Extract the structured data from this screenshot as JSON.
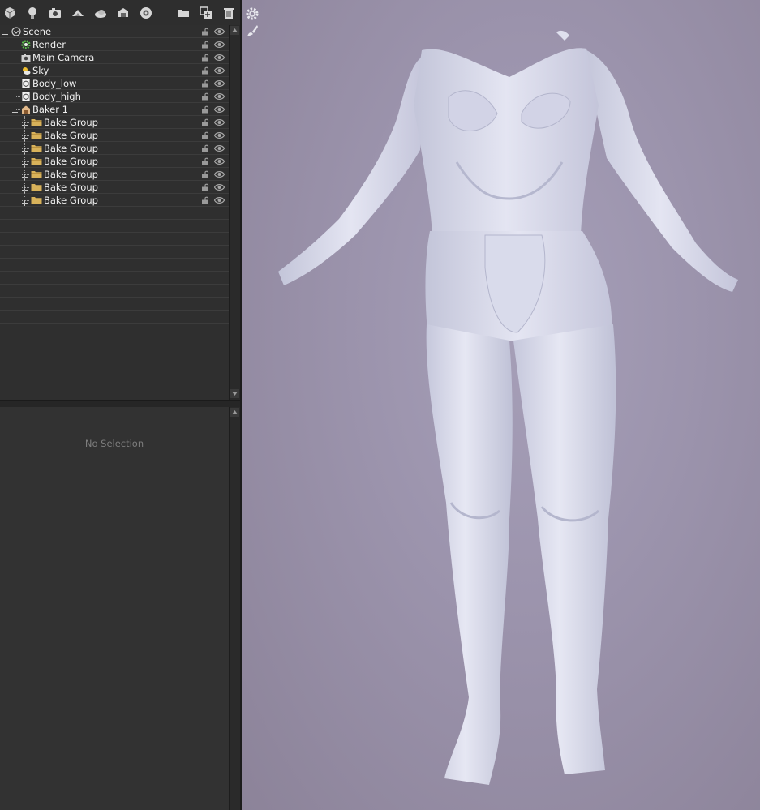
{
  "toolbar": {
    "icons": [
      "add-mesh-icon",
      "add-light-icon",
      "add-camera-icon",
      "add-sky-icon",
      "add-fog-icon",
      "add-baker-icon",
      "add-render-icon",
      "new-folder-icon",
      "duplicate-icon",
      "delete-icon"
    ]
  },
  "tree": {
    "rows": [
      {
        "label": "Scene",
        "icon": "scene-icon",
        "level": 0
      },
      {
        "label": "Render",
        "icon": "render-gear-icon",
        "level": 1
      },
      {
        "label": "Main Camera",
        "icon": "camera-icon",
        "level": 1
      },
      {
        "label": "Sky",
        "icon": "sky-icon",
        "level": 1
      },
      {
        "label": "Body_low",
        "icon": "mesh-icon",
        "level": 1
      },
      {
        "label": "Body_high",
        "icon": "mesh-icon",
        "level": 1
      },
      {
        "label": "Baker 1",
        "icon": "baker-icon",
        "level": 1
      },
      {
        "label": "Bake Group",
        "icon": "folder-icon",
        "level": 2
      },
      {
        "label": "Bake Group",
        "icon": "folder-icon",
        "level": 2
      },
      {
        "label": "Bake Group",
        "icon": "folder-icon",
        "level": 2
      },
      {
        "label": "Bake Group",
        "icon": "folder-icon",
        "level": 2
      },
      {
        "label": "Bake Group",
        "icon": "folder-icon",
        "level": 2
      },
      {
        "label": "Bake Group",
        "icon": "folder-icon",
        "level": 2
      },
      {
        "label": "Bake Group",
        "icon": "folder-icon",
        "level": 2
      }
    ]
  },
  "properties": {
    "empty_text": "No Selection"
  },
  "viewport": {
    "tools": [
      "settings-gear-icon",
      "brush-icon"
    ]
  },
  "colors": {
    "panel_bg": "#323232",
    "viewport_bg": "#9c94ad",
    "model": "#dadbe9",
    "folder": "#d8b25a",
    "render_gear": "#5bc44a"
  }
}
